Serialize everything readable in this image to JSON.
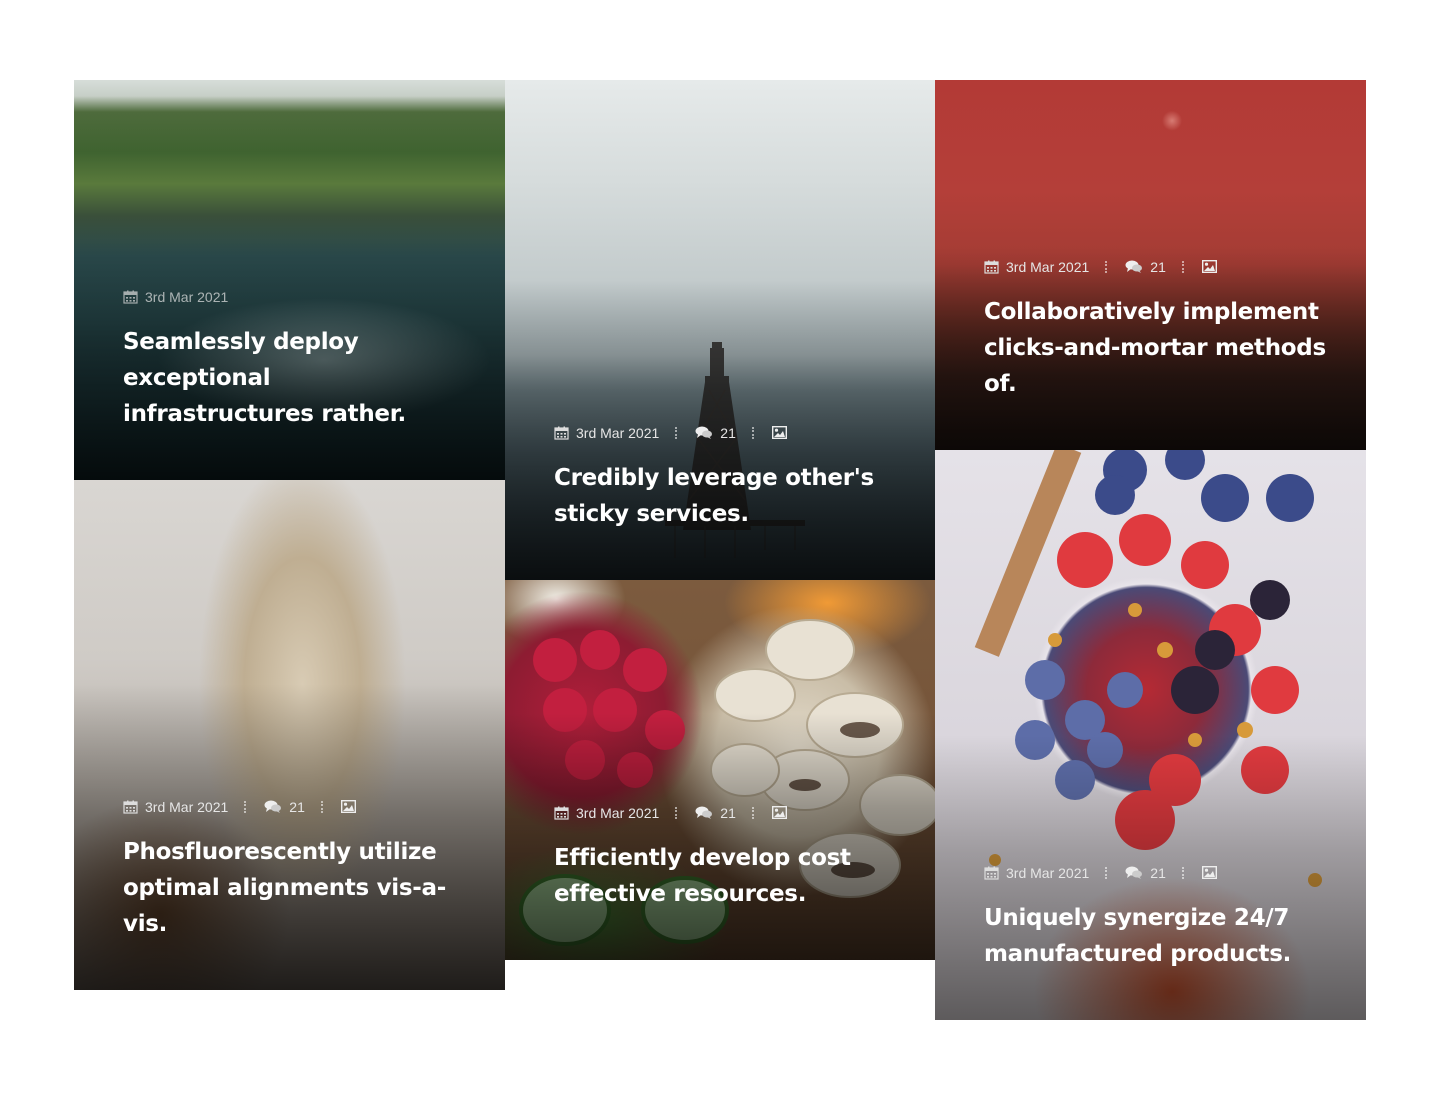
{
  "cards": [
    {
      "image": "aerial-coast-photo",
      "date": "3rd Mar 2021",
      "title": "Seamlessly deploy exceptional infrastructures rather."
    },
    {
      "image": "glass-jar-oats-photo",
      "date": "3rd Mar 2021",
      "comments": "21",
      "title": "Phosfluorescently utilize optimal alignments vis-a-vis."
    },
    {
      "image": "lighthouse-fog-photo",
      "date": "3rd Mar 2021",
      "comments": "21",
      "title": "Credibly leverage other's sticky services."
    },
    {
      "image": "vegetables-mushrooms-photo",
      "date": "3rd Mar 2021",
      "comments": "21",
      "title": "Efficiently develop cost effective resources."
    },
    {
      "image": "red-sky-moon-photo",
      "date": "3rd Mar 2021",
      "comments": "21",
      "title": "Collaboratively implement clicks-and-mortar methods of."
    },
    {
      "image": "berry-bowl-photo",
      "date": "3rd Mar 2021",
      "comments": "21",
      "title": "Uniquely synergize 24/7 manufactured products."
    }
  ],
  "icons": {
    "date": "calendar-icon",
    "comments": "comments-icon",
    "format": "image-icon"
  }
}
